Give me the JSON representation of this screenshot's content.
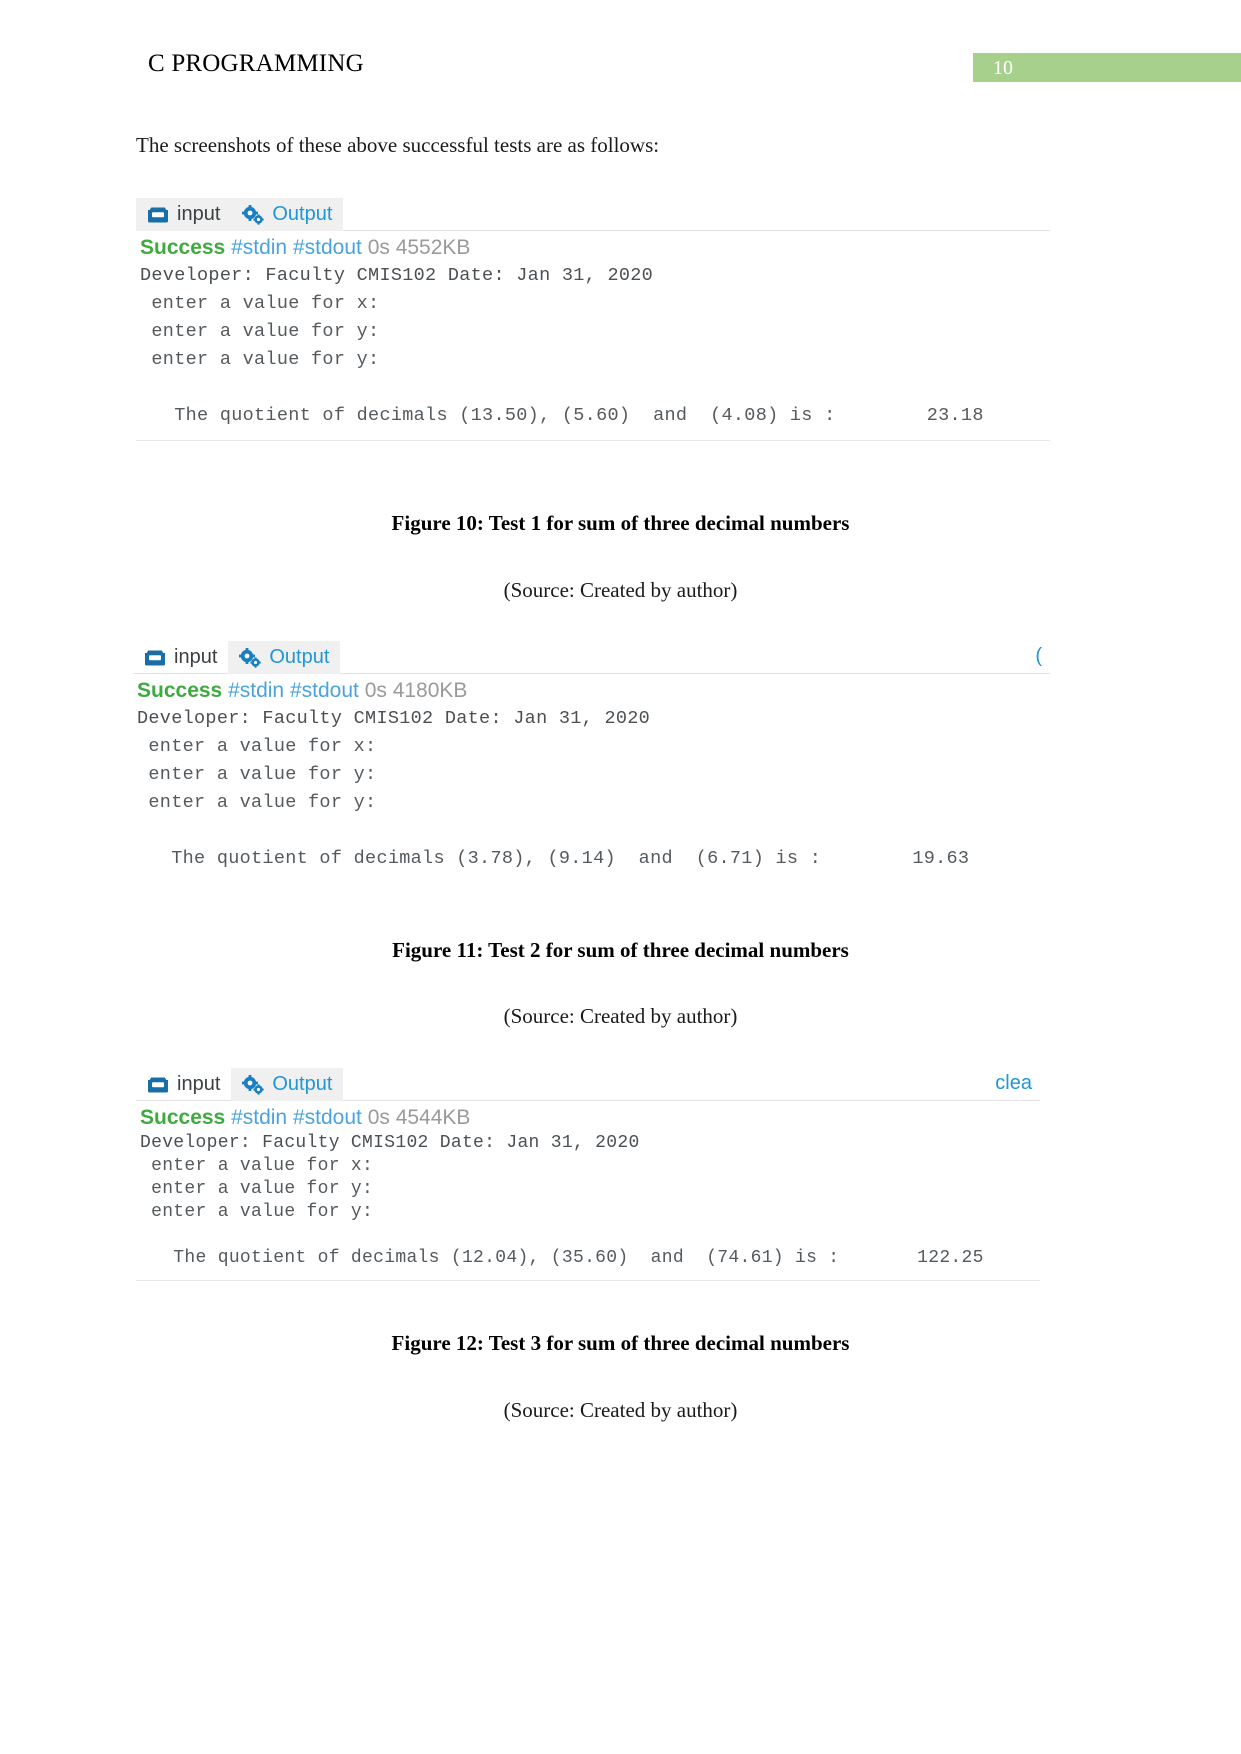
{
  "header": {
    "title": "C PROGRAMMING",
    "page_number": "10",
    "badge_color": "#a8d08d"
  },
  "intro_text": "The screenshots of these above successful tests are as follows:",
  "tabs": {
    "input_label": "input",
    "output_label": "Output",
    "input_icon": "inbox-icon",
    "output_icon": "gears-icon"
  },
  "colors": {
    "success": "#3faa3f",
    "stream": "#4aa3df",
    "meta": "#9a9a9a",
    "link": "#2196d6"
  },
  "blocks": [
    {
      "status": {
        "result": "Success",
        "streams": "#stdin #stdout",
        "meta": "0s 4552KB"
      },
      "clear_label": "",
      "console": [
        "Developer: Faculty CMIS102 Date: Jan 31, 2020",
        " enter a value for x:",
        " enter a value for y:",
        " enter a value for y:",
        "",
        "   The quotient of decimals (13.50), (5.60)  and  (4.08) is :        23.18"
      ],
      "figure_caption": "Figure 10: Test 1 for sum of three decimal numbers",
      "source_caption": "(Source: Created by author)"
    },
    {
      "status": {
        "result": "Success",
        "streams": "#stdin #stdout",
        "meta": "0s 4180KB"
      },
      "clear_label": "(",
      "console": [
        "Developer: Faculty CMIS102 Date: Jan 31, 2020",
        " enter a value for x:",
        " enter a value for y:",
        " enter a value for y:",
        "",
        "   The quotient of decimals (3.78), (9.14)  and  (6.71) is :        19.63"
      ],
      "figure_caption": "Figure 11: Test 2 for sum of three decimal numbers",
      "source_caption": "(Source: Created by author)"
    },
    {
      "status": {
        "result": "Success",
        "streams": "#stdin #stdout",
        "meta": "0s 4544KB"
      },
      "clear_label": "clea",
      "console": [
        "Developer: Faculty CMIS102 Date: Jan 31, 2020",
        " enter a value for x:",
        " enter a value for y:",
        " enter a value for y:",
        "",
        "   The quotient of decimals (12.04), (35.60)  and  (74.61) is :       122.25"
      ],
      "figure_caption": "Figure 12: Test 3 for sum of three decimal numbers",
      "source_caption": "(Source: Created by author)"
    }
  ]
}
